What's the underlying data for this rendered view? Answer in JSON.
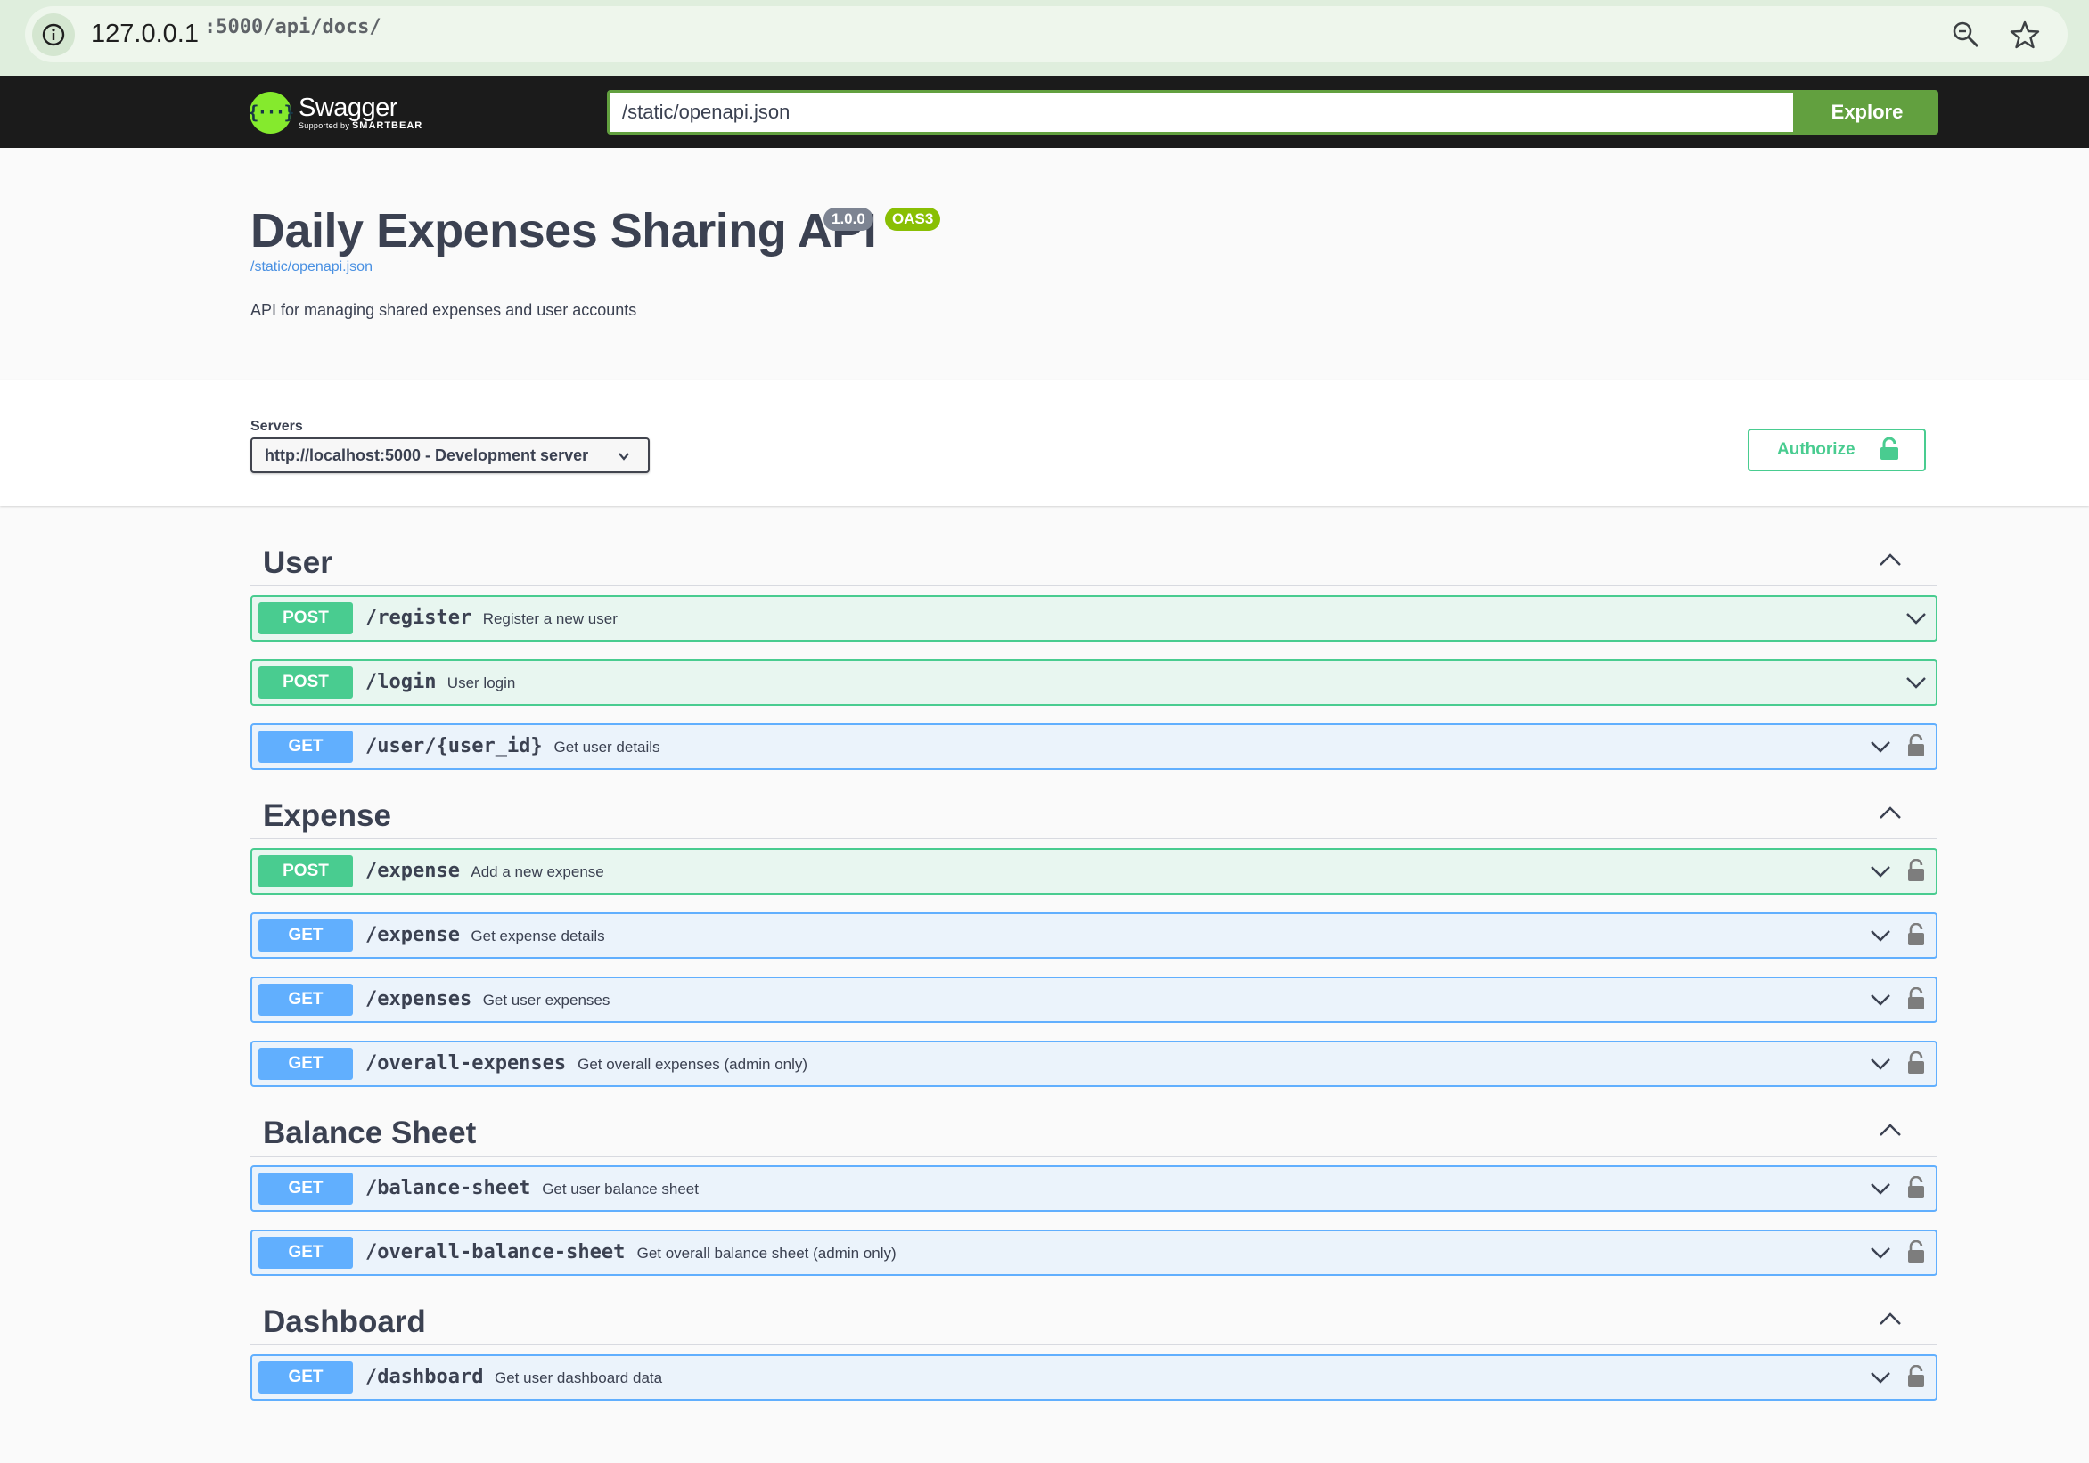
{
  "browser": {
    "url_host": "127.0.0.1",
    "url_path": ":5000/api/docs/"
  },
  "topbar": {
    "logo_title": "Swagger",
    "logo_supported": "Supported by",
    "logo_brand": "SMARTBEAR",
    "spec_url": "/static/openapi.json",
    "explore_label": "Explore"
  },
  "info": {
    "title": "Daily Expenses Sharing API",
    "version": "1.0.0",
    "oas": "OAS3",
    "spec_link": "/static/openapi.json",
    "description": "API for managing shared expenses and user accounts"
  },
  "servers": {
    "label": "Servers",
    "selected": "http://localhost:5000 - Development server",
    "authorize_label": "Authorize"
  },
  "colors": {
    "post": "#49cc90",
    "get": "#61affe",
    "explore": "#62a03f",
    "topbar": "#1b1b1b"
  },
  "tags": [
    {
      "name": "User",
      "operations": [
        {
          "method": "POST",
          "path": "/register",
          "summary": "Register a new user",
          "locked": false
        },
        {
          "method": "POST",
          "path": "/login",
          "summary": "User login",
          "locked": false
        },
        {
          "method": "GET",
          "path": "/user/{user_id}",
          "summary": "Get user details",
          "locked": true
        }
      ]
    },
    {
      "name": "Expense",
      "operations": [
        {
          "method": "POST",
          "path": "/expense",
          "summary": "Add a new expense",
          "locked": true
        },
        {
          "method": "GET",
          "path": "/expense",
          "summary": "Get expense details",
          "locked": true
        },
        {
          "method": "GET",
          "path": "/expenses",
          "summary": "Get user expenses",
          "locked": true
        },
        {
          "method": "GET",
          "path": "/overall-expenses",
          "summary": "Get overall expenses (admin only)",
          "locked": true
        }
      ]
    },
    {
      "name": "Balance Sheet",
      "operations": [
        {
          "method": "GET",
          "path": "/balance-sheet",
          "summary": "Get user balance sheet",
          "locked": true
        },
        {
          "method": "GET",
          "path": "/overall-balance-sheet",
          "summary": "Get overall balance sheet (admin only)",
          "locked": true
        }
      ]
    },
    {
      "name": "Dashboard",
      "operations": [
        {
          "method": "GET",
          "path": "/dashboard",
          "summary": "Get user dashboard data",
          "locked": true
        }
      ]
    }
  ]
}
